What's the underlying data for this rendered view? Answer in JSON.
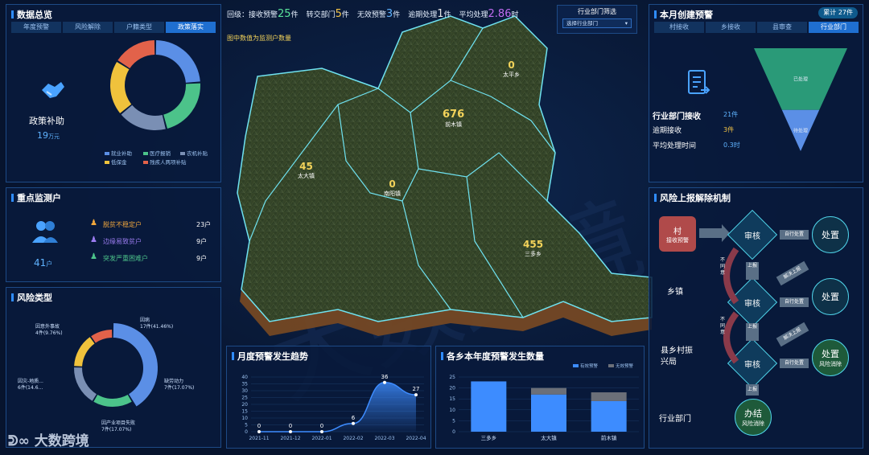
{
  "top_bar": {
    "items": [
      {
        "label": "回级：接收预警",
        "value": "25",
        "unit": "件",
        "color": "#59e39a"
      },
      {
        "label": "转交部门",
        "value": "5",
        "unit": "件",
        "color": "#f3c446"
      },
      {
        "label": "无效预警",
        "value": "3",
        "unit": "件",
        "color": "#5fb3ff"
      },
      {
        "label": "逾期处理",
        "value": "1",
        "unit": "件",
        "color": "#e3e3e3"
      },
      {
        "label": "平均处理",
        "value": "2.86",
        "unit": "时",
        "color": "#c16cf0"
      }
    ],
    "dept_filter_label": "行业部门筛选",
    "dept_select_placeholder": "选择行业部门"
  },
  "map": {
    "note": "图中数值为监测户数量",
    "regions": [
      {
        "value": "0",
        "name": "太平乡"
      },
      {
        "value": "676",
        "name": "前木镇"
      },
      {
        "value": "45",
        "name": "太大镇"
      },
      {
        "value": "0",
        "name": "南阳镇"
      },
      {
        "value": "455",
        "name": "三多乡"
      }
    ],
    "watermark_text": "大数跨境",
    "logo_text": "大数跨境"
  },
  "overview": {
    "title": "数据总览",
    "tabs": [
      "年度预警",
      "风险解除",
      "户籍类型",
      "政策落实"
    ],
    "active_tab": 3,
    "icon": "handshake-icon",
    "label": "政策补助",
    "value": "19",
    "unit": "万元",
    "donut_colors": [
      "#5b8fe6",
      "#4cc38a",
      "#7a8fb4",
      "#f0c23c",
      "#e2624a"
    ],
    "donut_values": [
      24,
      22,
      18,
      20,
      16
    ],
    "legend": [
      {
        "label": "就业补助",
        "color": "#5b8fe6"
      },
      {
        "label": "医疗报销",
        "color": "#4cc38a"
      },
      {
        "label": "农机补贴",
        "color": "#7a8fb4"
      },
      {
        "label": "低保金",
        "color": "#f0c23c"
      },
      {
        "label": "残疾人两项补贴",
        "color": "#e2624a"
      }
    ]
  },
  "monitor": {
    "title": "重点监测户",
    "icon": "people-icon",
    "value": "41",
    "unit": "户",
    "rows": [
      {
        "icon": "person-icon",
        "label": "脱贫不稳定户",
        "value": "23户",
        "color": "#f0a63c"
      },
      {
        "icon": "person-icon",
        "label": "边缘易致贫户",
        "value": "9户",
        "color": "#9b7cf0"
      },
      {
        "icon": "person-icon",
        "label": "突发严重困难户",
        "value": "9户",
        "color": "#4cc38a"
      }
    ]
  },
  "risk_types": {
    "title": "风险类型",
    "segments": [
      {
        "label": "因病\n17件(41.46%)",
        "value": 41.46,
        "color": "#5b8fe6"
      },
      {
        "label": "缺劳动力\n7件(17.07%)",
        "value": 17.07,
        "color": "#4cc38a"
      },
      {
        "label": "因产业项目失败\n7件(17.07%)",
        "value": 17.07,
        "color": "#7a8fb4"
      },
      {
        "label": "因灾-地质...\n6件(14.6...",
        "value": 14.63,
        "color": "#f0c23c"
      },
      {
        "label": "因意外事故\n4件(9.76%)",
        "value": 9.76,
        "color": "#e2624a"
      }
    ]
  },
  "monthly": {
    "title": "月度预警发生趋势",
    "chart_data": {
      "type": "area",
      "categories": [
        "2021-11",
        "2021-12",
        "2022-01",
        "2022-02",
        "2022-03",
        "2022-04"
      ],
      "values": [
        0,
        0,
        0,
        6,
        36,
        27
      ],
      "ylim": [
        0,
        40
      ],
      "yticks": [
        0,
        5,
        10,
        15,
        20,
        25,
        30,
        35,
        40
      ],
      "color": "#3d8cff"
    }
  },
  "towns": {
    "title": "各乡本年度预警发生数量",
    "chart_data": {
      "type": "bar",
      "categories": [
        "三多乡",
        "太大镇",
        "前木镇"
      ],
      "series": [
        {
          "name": "有效预警",
          "values": [
            23,
            17,
            14
          ],
          "color": "#3d8cff"
        },
        {
          "name": "无效预警",
          "values": [
            0,
            3,
            4
          ],
          "color": "#6b6f78"
        }
      ],
      "ylim": [
        0,
        25
      ],
      "yticks": [
        0,
        5,
        10,
        15,
        20,
        25
      ]
    }
  },
  "month_warn": {
    "title": "本月创建预警",
    "badge_label": "累计",
    "badge_value": "27件",
    "tabs": [
      "村接收",
      "乡接收",
      "县审查",
      "行业部门"
    ],
    "active_tab": 3,
    "icon": "document-icon",
    "rows": [
      {
        "label": "行业部门接收",
        "value": "21件",
        "color": "#5fb3ff"
      },
      {
        "label": "逾期接收",
        "value": "3件",
        "color": "#f3c446"
      },
      {
        "label": "平均处理时间",
        "value": "0.3时",
        "color": "#5fb3ff"
      }
    ],
    "funnel": [
      {
        "label": "已处理",
        "value": 0.6,
        "color": "#2a9a78"
      },
      {
        "label": "待处理",
        "value": 0.4,
        "color": "#5b8fe6"
      }
    ]
  },
  "mechanism": {
    "title": "风险上报解除机制",
    "village": "村",
    "village_sub": "接收预警",
    "review": "审核",
    "handle": "处置",
    "self_handle": "自行处置",
    "report_up": "上报",
    "resolve_report": "解决上报",
    "reject": "不同意",
    "level_town": "乡镇",
    "level_county": "县乡村振兴局",
    "level_dept": "行业部门",
    "handle_dissolve": "处置",
    "handle_dissolve_sub": "风险消除",
    "done": "办结",
    "done_sub": "风险消除"
  }
}
